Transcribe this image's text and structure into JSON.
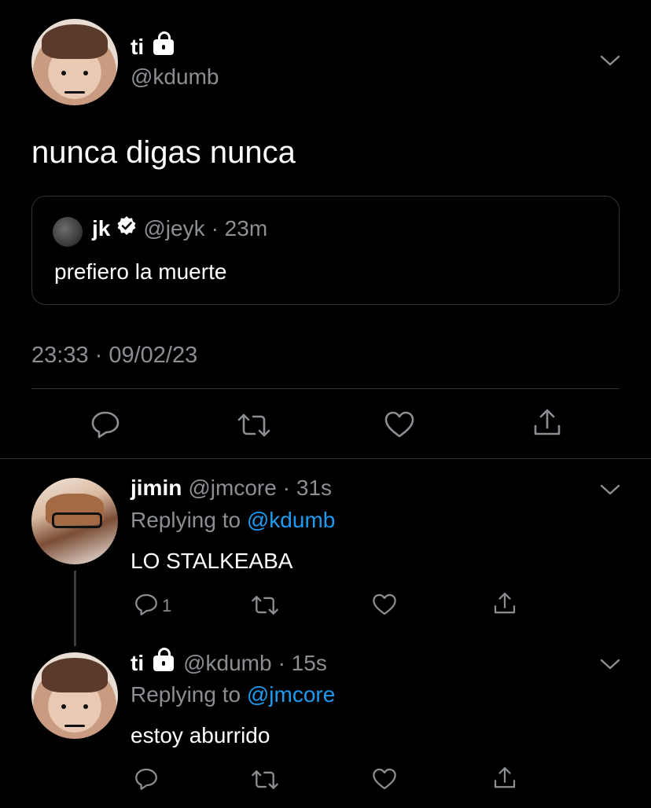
{
  "main_tweet": {
    "name": "ti",
    "handle": "@kdumb",
    "text": "nunca digas nunca",
    "timestamp": "23:33 · 09/02/23",
    "quoted": {
      "name": "jk",
      "handle": "@jeyk",
      "time": "· 23m",
      "text": "prefiero la muerte"
    }
  },
  "replies": [
    {
      "name": "jimin",
      "handle": "@jmcore",
      "time": "· 31s",
      "replying_prefix": "Replying to",
      "replying_to": "@kdumb",
      "text": "LO STALKEABA",
      "reply_count": "1"
    },
    {
      "name": "ti",
      "handle": "@kdumb",
      "time": "· 15s",
      "replying_prefix": "Replying to",
      "replying_to": "@jmcore",
      "text": "estoy aburrido"
    }
  ],
  "colors": {
    "background": "#000000",
    "secondary_text": "#8b8f94",
    "link": "#1d9bf0",
    "divider": "#2f3336"
  }
}
